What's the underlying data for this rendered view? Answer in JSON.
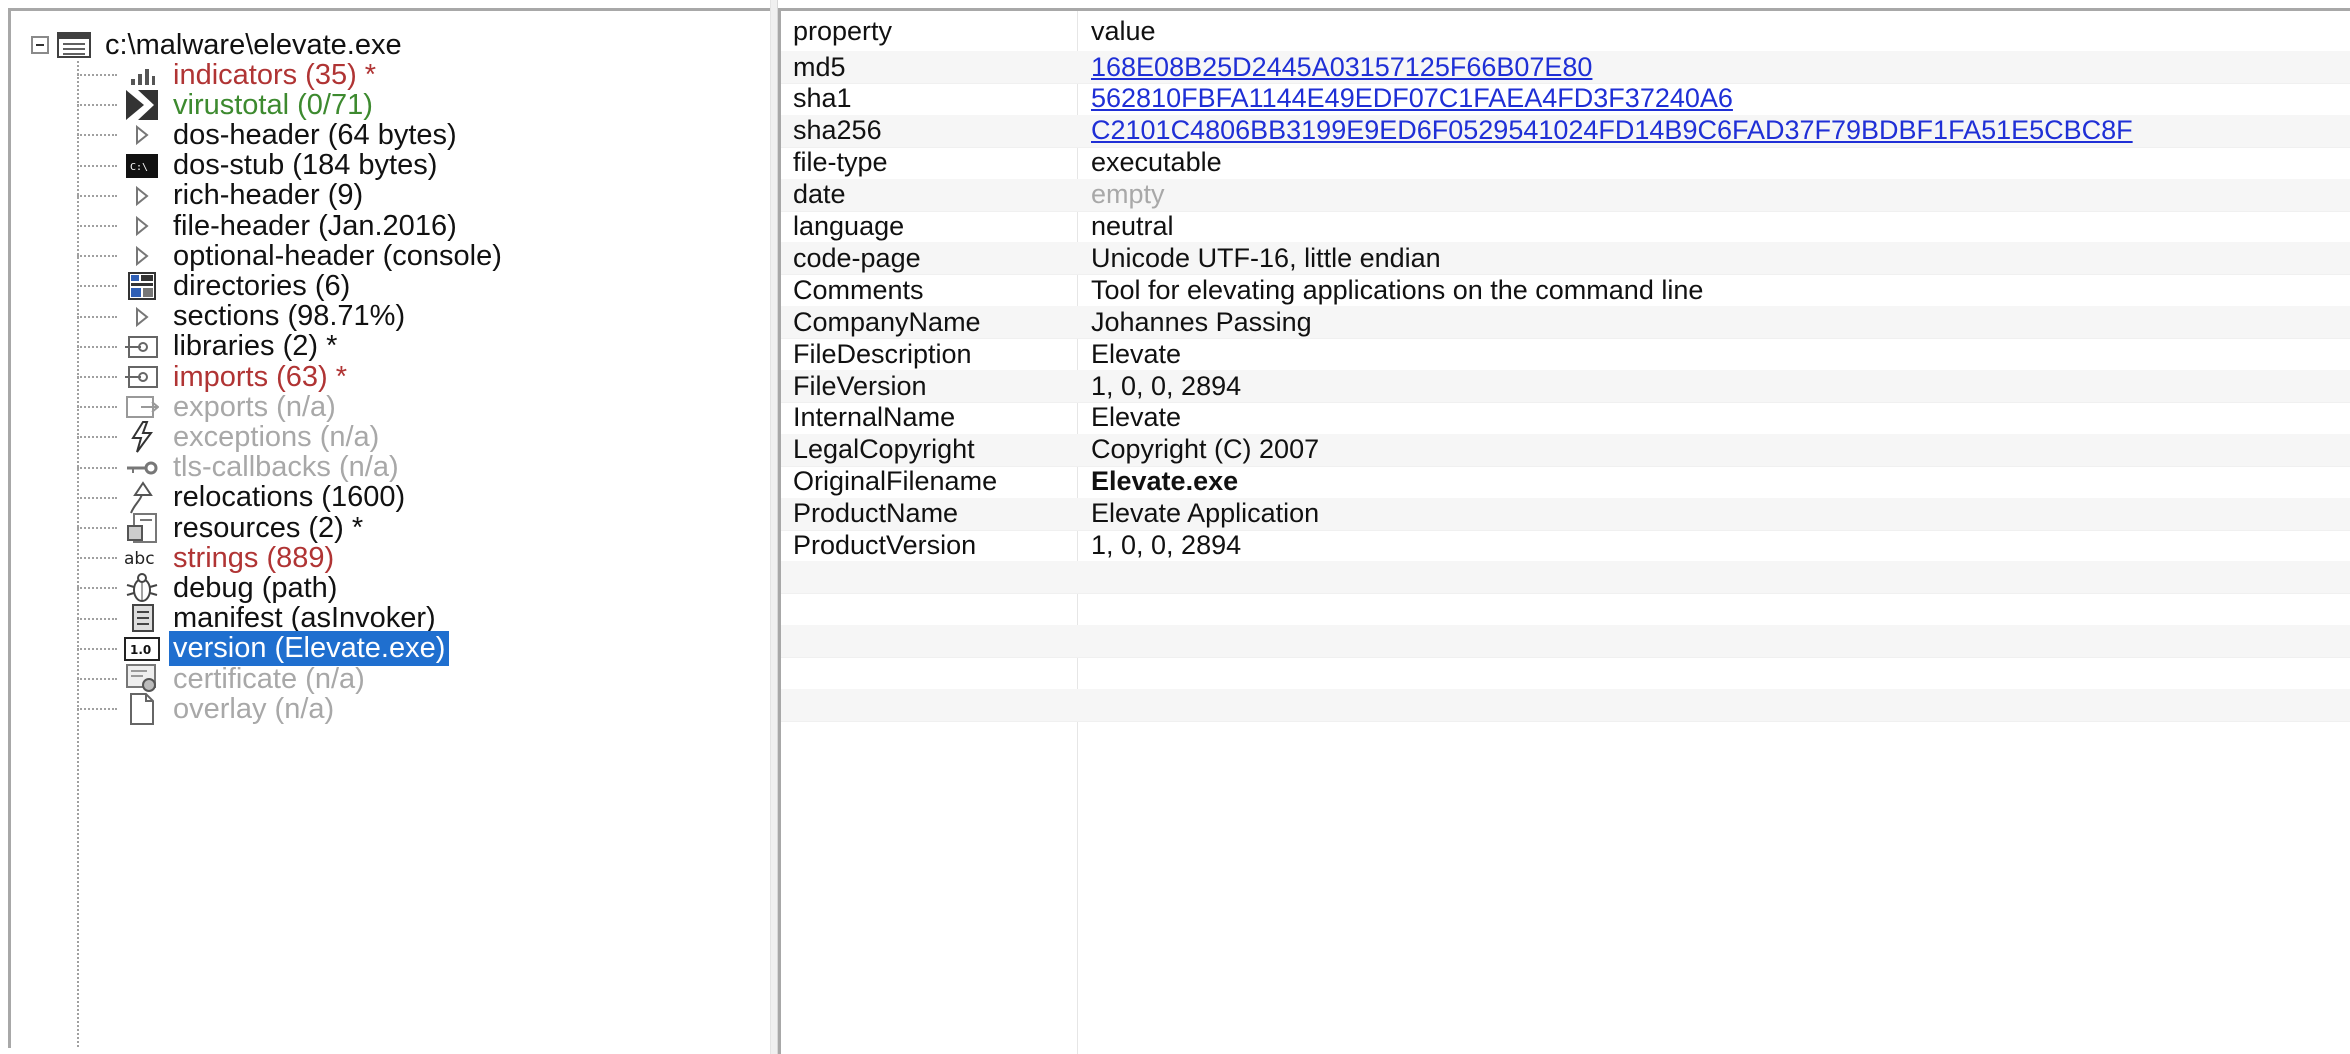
{
  "tree": {
    "root_label": "c:\\malware\\elevate.exe",
    "items": [
      {
        "label": "indicators (35) *",
        "style": "red",
        "icon": "chart-bars-icon"
      },
      {
        "label": "virustotal (0/71)",
        "style": "green",
        "icon": "virustotal-icon"
      },
      {
        "label": "dos-header (64 bytes)",
        "style": "normal",
        "icon": "triangle-right-icon"
      },
      {
        "label": "dos-stub (184 bytes)",
        "style": "normal",
        "icon": "console-icon"
      },
      {
        "label": "rich-header (9)",
        "style": "normal",
        "icon": "triangle-right-icon"
      },
      {
        "label": "file-header (Jan.2016)",
        "style": "normal",
        "icon": "triangle-right-icon"
      },
      {
        "label": "optional-header (console)",
        "style": "normal",
        "icon": "triangle-right-icon"
      },
      {
        "label": "directories (6)",
        "style": "normal",
        "icon": "directories-icon"
      },
      {
        "label": "sections (98.71%)",
        "style": "normal",
        "icon": "triangle-right-icon"
      },
      {
        "label": "libraries (2) *",
        "style": "normal",
        "icon": "library-icon"
      },
      {
        "label": "imports (63) *",
        "style": "red",
        "icon": "import-icon"
      },
      {
        "label": "exports (n/a)",
        "style": "gray",
        "icon": "export-icon"
      },
      {
        "label": "exceptions (n/a)",
        "style": "gray",
        "icon": "lightning-icon"
      },
      {
        "label": "tls-callbacks (n/a)",
        "style": "gray",
        "icon": "key-icon"
      },
      {
        "label": "relocations (1600)",
        "style": "normal",
        "icon": "relocation-arrow-icon"
      },
      {
        "label": "resources (2) *",
        "style": "normal",
        "icon": "resources-icon"
      },
      {
        "label": "strings (889)",
        "style": "red",
        "icon": "abc-icon"
      },
      {
        "label": "debug (path)",
        "style": "normal",
        "icon": "bug-icon"
      },
      {
        "label": "manifest (asInvoker)",
        "style": "normal",
        "icon": "manifest-icon"
      },
      {
        "label": "version (Elevate.exe)",
        "style": "selected",
        "icon": "version-icon"
      },
      {
        "label": "certificate (n/a)",
        "style": "gray",
        "icon": "certificate-icon"
      },
      {
        "label": "overlay (n/a)",
        "style": "gray",
        "icon": "blank-page-icon"
      }
    ]
  },
  "grid": {
    "header_property": "property",
    "header_value": "value",
    "rows": [
      {
        "property": "md5",
        "value": "168E08B25D2445A03157125F66B07E80",
        "style": "link"
      },
      {
        "property": "sha1",
        "value": "562810FBFA1144E49EDF07C1FAEA4FD3F37240A6",
        "style": "link"
      },
      {
        "property": "sha256",
        "value": "C2101C4806BB3199E9ED6F0529541024FD14B9C6FAD37F79BDBF1FA51E5CBC8F",
        "style": "link"
      },
      {
        "property": "file-type",
        "value": "executable",
        "style": "normal"
      },
      {
        "property": "date",
        "value": "empty",
        "style": "dim"
      },
      {
        "property": "language",
        "value": "neutral",
        "style": "normal"
      },
      {
        "property": "code-page",
        "value": "Unicode UTF-16, little endian",
        "style": "normal"
      },
      {
        "property": "Comments",
        "value": "Tool for elevating applications on the command line",
        "style": "normal"
      },
      {
        "property": "CompanyName",
        "value": "Johannes Passing",
        "style": "normal"
      },
      {
        "property": "FileDescription",
        "value": "Elevate",
        "style": "normal"
      },
      {
        "property": "FileVersion",
        "value": "1, 0, 0, 2894",
        "style": "normal"
      },
      {
        "property": "InternalName",
        "value": "Elevate",
        "style": "normal"
      },
      {
        "property": "LegalCopyright",
        "value": "Copyright (C) 2007",
        "style": "normal"
      },
      {
        "property": "OriginalFilename",
        "value": "Elevate.exe",
        "style": "bold"
      },
      {
        "property": "ProductName",
        "value": "Elevate Application",
        "style": "normal"
      },
      {
        "property": "ProductVersion",
        "value": "1, 0, 0, 2894",
        "style": "normal"
      }
    ],
    "empty_rows": 5
  }
}
